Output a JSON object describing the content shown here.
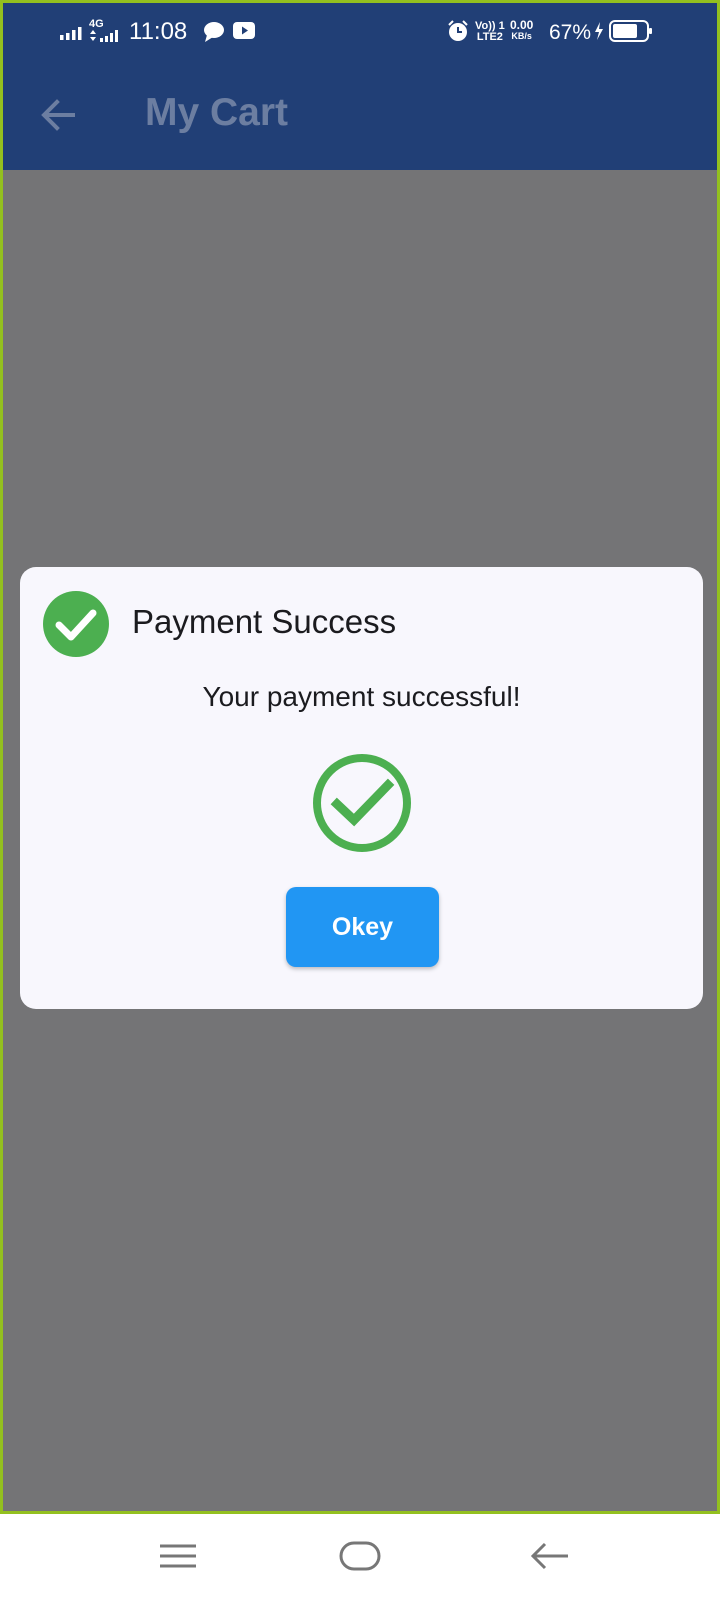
{
  "status_bar": {
    "network_type": "4G",
    "time": "11:08",
    "volte_line1": "Vo)) 1",
    "volte_line2": "LTE2",
    "net_speed_value": "0.00",
    "net_speed_unit": "KB/s",
    "battery_percent": "67%",
    "icons": [
      "signal-icon",
      "signal-4g-icon",
      "message-icon",
      "youtube-icon",
      "alarm-icon",
      "volte-icon",
      "charging-icon",
      "battery-icon"
    ]
  },
  "app_bar": {
    "title": "My Cart",
    "back_icon": "back-arrow-icon"
  },
  "dialog": {
    "title": "Payment Success",
    "message": "Your payment successful!",
    "button_label": "Okey",
    "icons": [
      "check-circle-icon",
      "success-check-ring-icon"
    ]
  },
  "nav_bar": {
    "icons": [
      "menu-icon",
      "home-icon",
      "back-icon"
    ]
  },
  "colors": {
    "app_bar": "#213f76",
    "scrim": "#747476",
    "dialog_bg": "#f8f7fd",
    "success_green": "#4caf50",
    "button_blue": "#2196f3",
    "frame_border": "#93c01f"
  }
}
